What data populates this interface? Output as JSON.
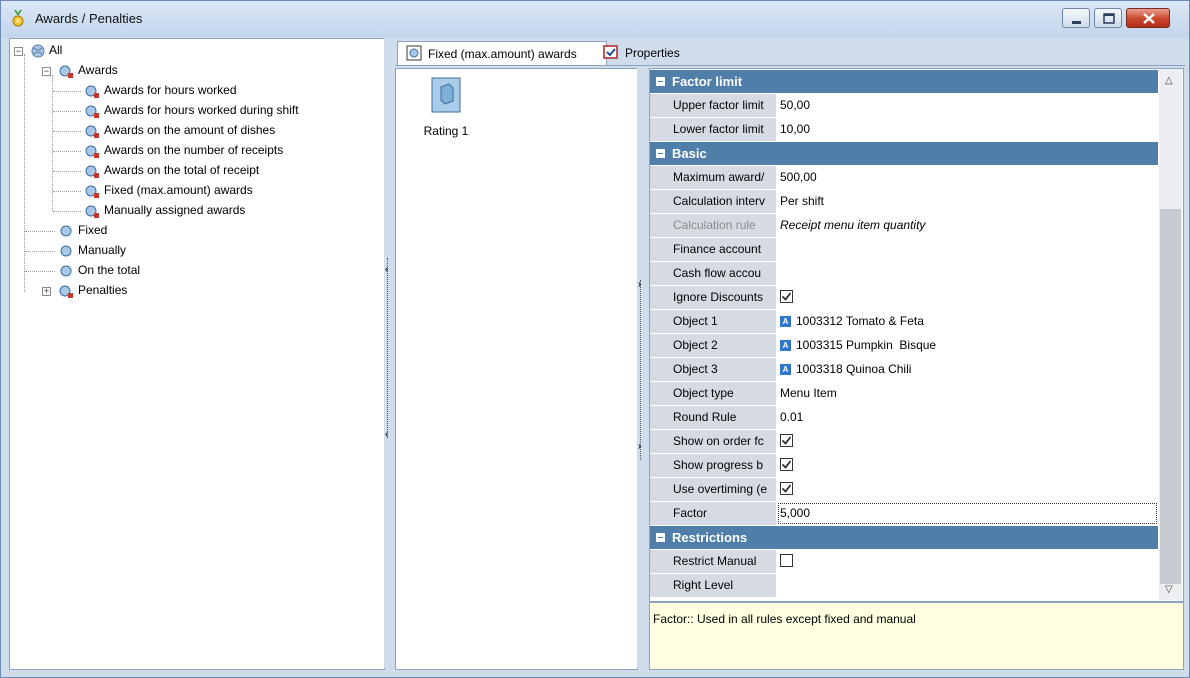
{
  "window": {
    "title": "Awards / Penalties"
  },
  "tree": {
    "root": "All",
    "awards": "Awards",
    "award_items": [
      "Awards for hours worked",
      "Awards for hours worked during shift",
      "Awards on the amount of dishes",
      "Awards on the number of receipts",
      "Awards on the total of receipt",
      "Fixed (max.amount) awards",
      "Manually assigned awards"
    ],
    "fixed": "Fixed",
    "manually": "Manually",
    "on_total": "On the total",
    "penalties": "Penalties"
  },
  "tabs": [
    {
      "label": "Fixed (max.amount) awards"
    },
    {
      "label": "Properties"
    }
  ],
  "list": {
    "items": [
      {
        "label": "Rating 1"
      }
    ]
  },
  "properties": {
    "categories": {
      "factor_limit": "Factor limit",
      "basic": "Basic",
      "restrictions": "Restrictions"
    },
    "rows": {
      "upper": {
        "name": "Upper factor limit",
        "value": "50,00"
      },
      "lower": {
        "name": "Lower factor limit",
        "value": "10,00"
      },
      "max_award": {
        "name": "Maximum award/",
        "value": "500,00"
      },
      "calc_interval": {
        "name": "Calculation interv",
        "value": "Per shift"
      },
      "calc_rule": {
        "name": "Calculation rule",
        "value": "Receipt menu item quantity"
      },
      "finance": {
        "name": "Finance account",
        "value": ""
      },
      "cashflow": {
        "name": "Cash flow accou",
        "value": ""
      },
      "ignore_discounts": {
        "name": "Ignore Discounts",
        "checked": true
      },
      "object1": {
        "name": "Object 1",
        "value": "1003312 Tomato & Feta",
        "icon": "A"
      },
      "object2": {
        "name": "Object 2",
        "value": "1003315 Pumpkin  Bisque",
        "icon": "A"
      },
      "object3": {
        "name": "Object 3",
        "value": "1003318 Quinoa Chili",
        "icon": "A"
      },
      "object_type": {
        "name": "Object type",
        "value": "Menu Item"
      },
      "round_rule": {
        "name": "Round Rule",
        "value": "0.01"
      },
      "show_order": {
        "name": "Show on order fc",
        "checked": true
      },
      "show_progress": {
        "name": "Show progress b",
        "checked": true
      },
      "use_overtiming": {
        "name": "Use overtiming (e",
        "checked": true
      },
      "factor": {
        "name": "Factor",
        "value": "5,000"
      },
      "restrict_manual": {
        "name": "Restrict Manual",
        "checked": false
      },
      "right_level": {
        "name": "Right Level",
        "value": ""
      }
    }
  },
  "description": {
    "text": "Factor:: Used in all rules except fixed and manual"
  },
  "colors": {
    "category_bg": "#4f7fa8",
    "name_bg": "#d6dbe3",
    "description_bg": "#ffffe1",
    "window_frame": "#cfdcec"
  }
}
